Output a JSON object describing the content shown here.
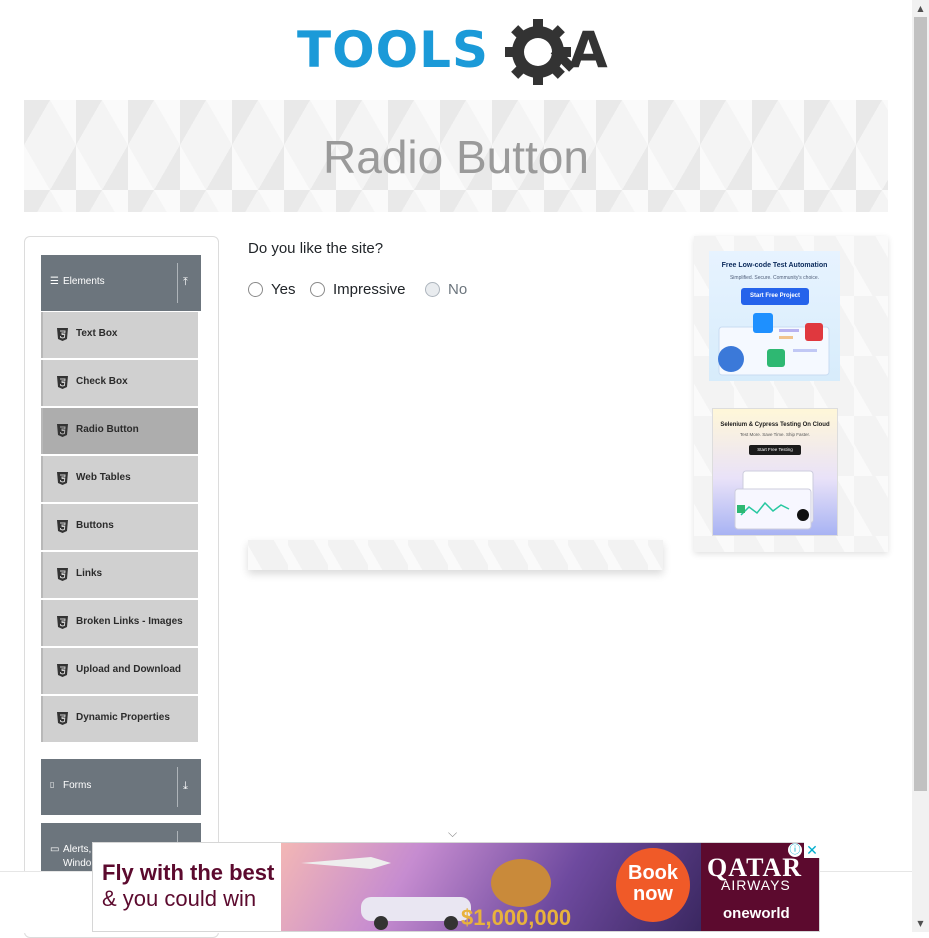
{
  "header": {
    "logo_text": "TOOLSQA"
  },
  "banner": {
    "title": "Radio Button"
  },
  "sidebar": {
    "groups": [
      {
        "label": "Elements",
        "expanded": true
      },
      {
        "label": "Forms",
        "expanded": false
      },
      {
        "label": "Alerts, Frame & Windows",
        "expanded": false,
        "visible_label": "Alerts,\nWindo"
      }
    ],
    "items": [
      {
        "label": "Text Box",
        "active": false
      },
      {
        "label": "Check Box",
        "active": false
      },
      {
        "label": "Radio Button",
        "active": true
      },
      {
        "label": "Web Tables",
        "active": false
      },
      {
        "label": "Buttons",
        "active": false
      },
      {
        "label": "Links",
        "active": false
      },
      {
        "label": "Broken Links - Images",
        "active": false
      },
      {
        "label": "Upload and Download",
        "active": false
      },
      {
        "label": "Dynamic Properties",
        "active": false
      }
    ]
  },
  "form": {
    "question": "Do you like the site?",
    "options": [
      {
        "label": "Yes",
        "checked": false,
        "disabled": false
      },
      {
        "label": "Impressive",
        "checked": false,
        "disabled": false
      },
      {
        "label": "No",
        "checked": false,
        "disabled": true
      }
    ]
  },
  "ads": {
    "right_top": {
      "title": "Free Low-code Test Automation",
      "subtitle": "Simplified. Secure. Community's choice.",
      "button": "Start Free Project"
    },
    "right_bottom": {
      "title": "Selenium & Cypress Testing On Cloud",
      "subtitle": "Test More. Save Time. Ship Faster.",
      "button": "Start Free Testing"
    },
    "bottom": {
      "line1": "Fly with the best",
      "line2": "& you could win",
      "cta": "Book now",
      "brand": "QATAR",
      "brand_sub": "AIRWAYS",
      "alliance": "oneworld"
    }
  },
  "colors": {
    "logo_blue": "#1b9ad8",
    "menu_header": "#6c757d",
    "menu_item": "#d0d0d0",
    "menu_active": "#adadad",
    "qatar": "#5c0a2e"
  }
}
